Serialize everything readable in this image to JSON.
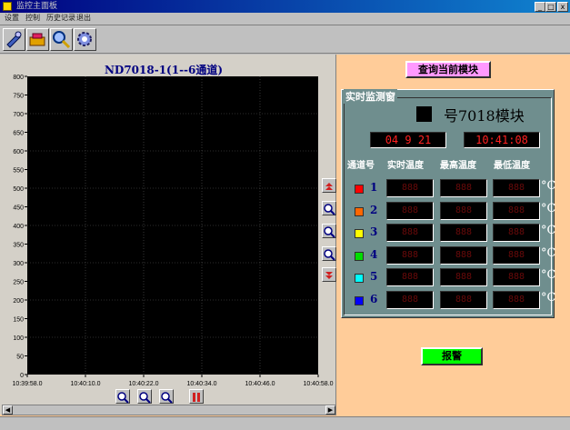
{
  "window": {
    "title": "监控主面板",
    "minimize": "_",
    "maximize": "□",
    "close": "x"
  },
  "menu": [
    "设置",
    "控制",
    "历史记录",
    "退出"
  ],
  "toolbar": [
    "settings-icon",
    "module-icon",
    "search-icon",
    "gear-icon"
  ],
  "chart_data": {
    "type": "line",
    "title": "ND7018-1(1--6通道)",
    "x_ticks": [
      "10:39:58.0",
      "10:40:10.0",
      "10:40:22.0",
      "10:40:34.0",
      "10:40:46.0",
      "10:40:58.0"
    ],
    "y_ticks": [
      "0",
      "50",
      "100",
      "150",
      "200",
      "250",
      "300",
      "350",
      "400",
      "450",
      "500",
      "550",
      "600",
      "650",
      "700",
      "750",
      "800"
    ],
    "ylim": [
      0,
      800
    ],
    "grid": true,
    "series": []
  },
  "chart_controls": {
    "side": [
      "scroll-up-icon",
      "zoom-in-icon",
      "zoom-fit-icon",
      "zoom-out-icon",
      "scroll-down-icon"
    ],
    "bottom": [
      "zoom-in-icon",
      "zoom-fit-icon",
      "zoom-out-icon",
      "pause-icon"
    ]
  },
  "query_button": "查询当前模块",
  "monitor": {
    "label": "实时监测窗",
    "module_title": "号7018模块",
    "date": "04  9 21",
    "time": "10:41:08",
    "headers": [
      "通道号",
      "实时温度",
      "最高温度",
      "最低温度"
    ],
    "unit": "°C",
    "channels": [
      {
        "num": "1",
        "color": "#ff0000",
        "current": "888",
        "max": "888",
        "min": "888"
      },
      {
        "num": "2",
        "color": "#ff6600",
        "current": "888",
        "max": "888",
        "min": "888"
      },
      {
        "num": "3",
        "color": "#ffff00",
        "current": "888",
        "max": "888",
        "min": "888"
      },
      {
        "num": "4",
        "color": "#00dd00",
        "current": "888",
        "max": "888",
        "min": "888"
      },
      {
        "num": "5",
        "color": "#00ffff",
        "current": "888",
        "max": "888",
        "min": "888"
      },
      {
        "num": "6",
        "color": "#0000ff",
        "current": "888",
        "max": "888",
        "min": "888"
      }
    ]
  },
  "alarm_button": "报警"
}
